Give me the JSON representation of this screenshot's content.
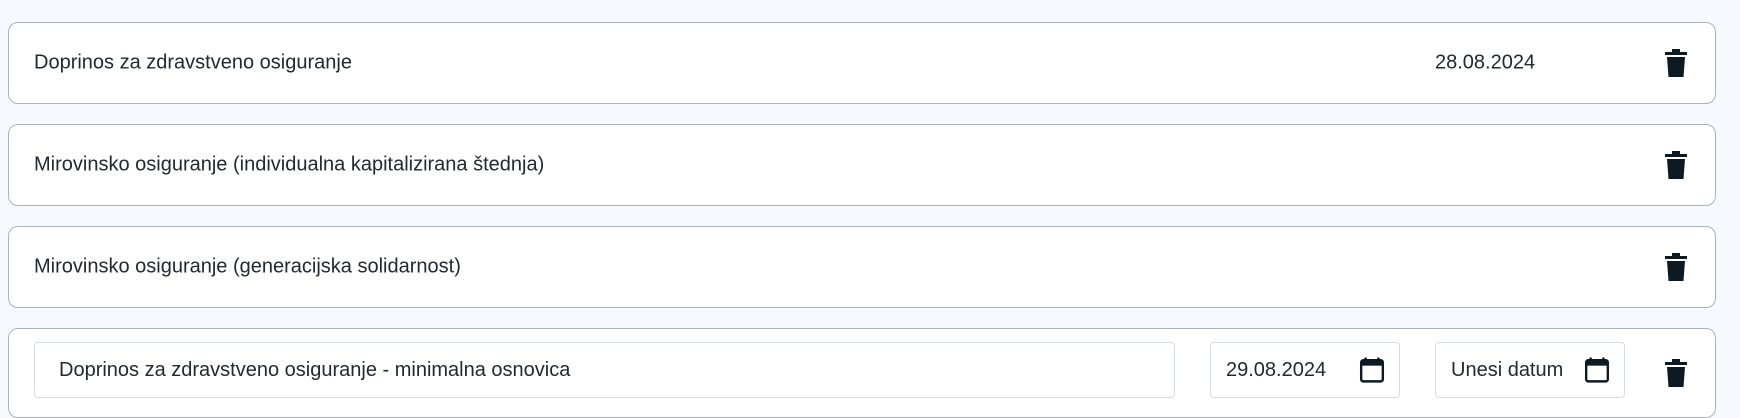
{
  "colors": {
    "page_bg": "#f6f9fd",
    "card_bg": "#ffffff",
    "card_border": "#aab3bc",
    "icon": "#0d1a24",
    "text": "#222a31"
  },
  "rows": [
    {
      "label": "Doprinos za zdravstveno osiguranje",
      "date": "28.08.2024",
      "icon": "trash-icon"
    },
    {
      "label": "Mirovinsko osiguranje (individualna kapitalizirana štednja)",
      "date": "",
      "icon": "trash-icon"
    },
    {
      "label": "Mirovinsko osiguranje (generacijska solidarnost)",
      "date": "",
      "icon": "trash-icon"
    }
  ],
  "edit_row": {
    "description_value": "Doprinos za zdravstveno osiguranje - minimalna osnovica",
    "date_from_value": "29.08.2024",
    "date_to_placeholder": "Unesi datum",
    "calendar_icon": "calendar-icon",
    "delete_icon": "trash-icon"
  }
}
